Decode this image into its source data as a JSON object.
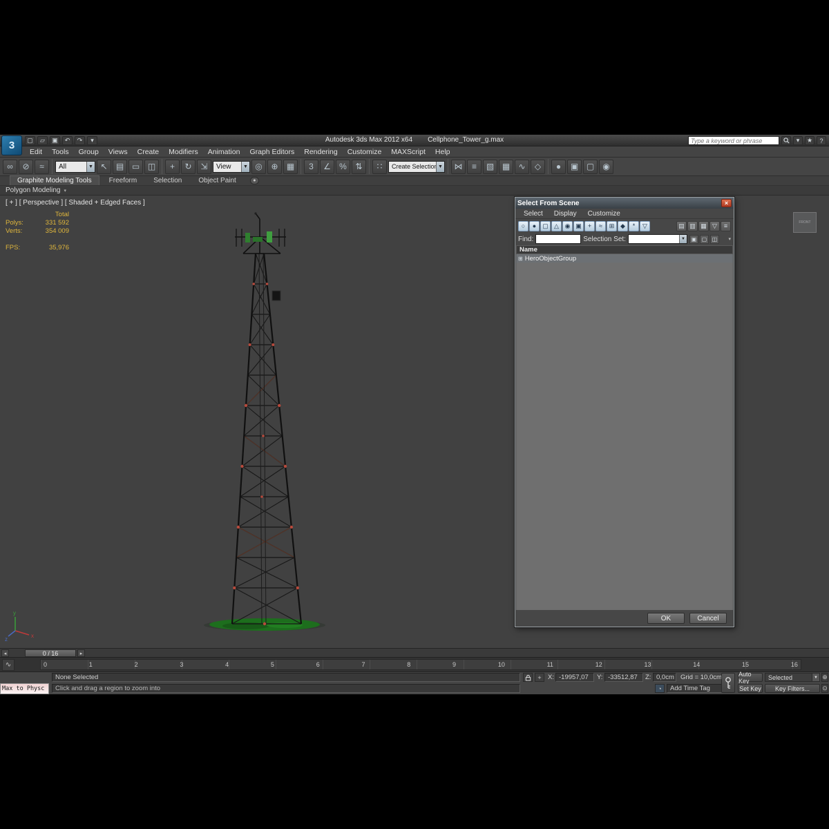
{
  "colors": {
    "accent_blue": "#9db8d2",
    "stats_yellow": "#dfb63c",
    "ground_green": "#2f8f2f",
    "marker_red": "#b84a3c",
    "viewport_bg": "#414141",
    "dialog_list_bg": "#6f6f6f"
  },
  "titlebar": {
    "app_title": "Autodesk 3ds Max 2012 x64",
    "doc_title": "Cellphone_Tower_g.max",
    "search_placeholder": "Type a keyword or phrase",
    "logo_glyph": "3",
    "quick_access": [
      {
        "name": "new-scene-icon",
        "glyph": "▢"
      },
      {
        "name": "open-file-icon",
        "glyph": "▱"
      },
      {
        "name": "save-file-icon",
        "glyph": "▣"
      },
      {
        "name": "undo-icon",
        "glyph": "↶"
      },
      {
        "name": "redo-icon",
        "glyph": "↷"
      },
      {
        "name": "project-folder-icon",
        "glyph": "▾"
      }
    ],
    "infocenter": {
      "dropdown_glyph": "▾",
      "star_glyph": "★",
      "help_glyph": "?"
    }
  },
  "menubar": {
    "items": [
      "Edit",
      "Tools",
      "Group",
      "Views",
      "Create",
      "Modifiers",
      "Animation",
      "Graph Editors",
      "Rendering",
      "Customize",
      "MAXScript",
      "Help"
    ]
  },
  "toolbar": {
    "group_link": [
      {
        "name": "select-and-link-icon",
        "glyph": "∞"
      },
      {
        "name": "unlink-selection-icon",
        "glyph": "⊘"
      },
      {
        "name": "bind-to-space-warp-icon",
        "glyph": "≈"
      }
    ],
    "selection_filter_value": "All",
    "group_select": [
      {
        "name": "select-object-icon",
        "glyph": "↖"
      },
      {
        "name": "select-by-name-icon",
        "glyph": "▤"
      },
      {
        "name": "selection-region-icon",
        "glyph": "▭"
      },
      {
        "name": "window-crossing-icon",
        "glyph": "◫"
      }
    ],
    "group_transform": [
      {
        "name": "select-and-move-icon",
        "glyph": "+"
      },
      {
        "name": "select-and-rotate-icon",
        "glyph": "↻"
      },
      {
        "name": "select-and-scale-icon",
        "glyph": "⇲"
      }
    ],
    "coordinate_system_value": "View",
    "group_pivot": [
      {
        "name": "use-pivot-point-icon",
        "glyph": "◎"
      },
      {
        "name": "select-and-manipulate-icon",
        "glyph": "⊕"
      },
      {
        "name": "keyboard-override-icon",
        "glyph": "▦"
      }
    ],
    "group_snaps": [
      {
        "name": "snaps-toggle-icon",
        "glyph": "3"
      },
      {
        "name": "angle-snap-icon",
        "glyph": "∠"
      },
      {
        "name": "percent-snap-icon",
        "glyph": "%"
      },
      {
        "name": "spinner-snap-icon",
        "glyph": "⇅"
      }
    ],
    "group_named": [
      {
        "name": "named-selection-sets-icon",
        "glyph": "∷"
      }
    ],
    "named_selection_value": "Create Selection Se",
    "group_tools": [
      {
        "name": "mirror-icon",
        "glyph": "⋈"
      },
      {
        "name": "align-icon",
        "glyph": "≡"
      },
      {
        "name": "layer-manager-icon",
        "glyph": "▧"
      },
      {
        "name": "ribbon-toggle-icon",
        "glyph": "▦"
      },
      {
        "name": "curve-editor-icon",
        "glyph": "∿"
      },
      {
        "name": "schematic-view-icon",
        "glyph": "◇"
      }
    ],
    "group_render": [
      {
        "name": "material-editor-icon",
        "glyph": "●"
      },
      {
        "name": "render-setup-icon",
        "glyph": "▣"
      },
      {
        "name": "rendered-frame-icon",
        "glyph": "▢"
      },
      {
        "name": "render-production-icon",
        "glyph": "◉"
      }
    ]
  },
  "ribbon": {
    "tabs": [
      "Graphite Modeling Tools",
      "Freeform",
      "Selection",
      "Object Paint"
    ],
    "minimize_glyph": "●",
    "panel_label": "Polygon Modeling",
    "panel_arrow": "▾"
  },
  "viewport": {
    "label": "[ + ] [ Perspective ] [ Shaded + Edged Faces ]",
    "stats": [
      {
        "label": "",
        "value": "Total"
      },
      {
        "label": "Polys:",
        "value": "331 592"
      },
      {
        "label": "Verts:",
        "value": "354 009"
      }
    ],
    "fps_label": "FPS:",
    "fps_value": "35,976",
    "viewcube_label": "FRONT"
  },
  "dialog": {
    "title": "Select From Scene",
    "close_glyph": "×",
    "menu": [
      "Select",
      "Display",
      "Customize"
    ],
    "toolbar_icons": [
      {
        "name": "display-none-icon",
        "glyph": "○"
      },
      {
        "name": "display-all-icon",
        "glyph": "●"
      },
      {
        "name": "display-geometry-icon",
        "glyph": "▢"
      },
      {
        "name": "display-shapes-icon",
        "glyph": "△"
      },
      {
        "name": "display-lights-icon",
        "glyph": "◉"
      },
      {
        "name": "display-cameras-icon",
        "glyph": "▣"
      },
      {
        "name": "display-helpers-icon",
        "glyph": "+"
      },
      {
        "name": "display-spacewarps-icon",
        "glyph": "≈"
      },
      {
        "name": "display-groups-icon",
        "glyph": "⊞"
      },
      {
        "name": "display-bones-icon",
        "glyph": "◆"
      },
      {
        "name": "display-frozen-icon",
        "glyph": "*"
      },
      {
        "name": "display-hidden-icon",
        "glyph": "▽"
      }
    ],
    "view_icons": [
      {
        "name": "list-view-icon",
        "glyph": "▤"
      },
      {
        "name": "detail-view-icon",
        "glyph": "▥"
      },
      {
        "name": "column-chooser-icon",
        "glyph": "▦"
      },
      {
        "name": "filter-icon",
        "glyph": "▽"
      },
      {
        "name": "display-children-icon",
        "glyph": "≡"
      }
    ],
    "find_label": "Find:",
    "find_value": "",
    "selection_set_label": "Selection Set:",
    "selection_set_value": "",
    "set_icons": [
      {
        "name": "select-all-icon",
        "glyph": "▣"
      },
      {
        "name": "select-none-icon",
        "glyph": "▢"
      },
      {
        "name": "select-invert-icon",
        "glyph": "◫"
      }
    ],
    "more_glyph": "▾",
    "column_header": "Name",
    "items": [
      {
        "name": "HeroObjectGroup",
        "icon": "⊞"
      }
    ],
    "ok_label": "OK",
    "cancel_label": "Cancel"
  },
  "timeline": {
    "slider_value": "0 / 16",
    "left_arrow": "◂",
    "right_arrow": "▸",
    "curve_editor_glyph": "∿",
    "ticks": [
      "0",
      "1",
      "2",
      "3",
      "4",
      "5",
      "6",
      "7",
      "8",
      "9",
      "10",
      "11",
      "12",
      "13",
      "14",
      "15",
      "16"
    ]
  },
  "statusbar": {
    "mini_listener_text": "Max to Physc",
    "selection_status": "None Selected",
    "prompt_text": "Click and drag a region to zoom into",
    "absolute_mode_glyph": "+",
    "x_label": "X:",
    "x_value": "-19957,07",
    "y_label": "Y:",
    "y_value": "-33512,87",
    "z_label": "Z:",
    "z_value": "0,0cm",
    "grid_text": "Grid = 10,0cm",
    "time_tag_glyph": "◔",
    "add_time_tag": "Add Time Tag",
    "auto_key_label": "Auto Key",
    "set_key_label": "Set Key",
    "selected_value": "Selected",
    "key_filters_label": "Key Filters...",
    "pan_glyph": "⊕",
    "zoom_glyph": "⊙"
  }
}
